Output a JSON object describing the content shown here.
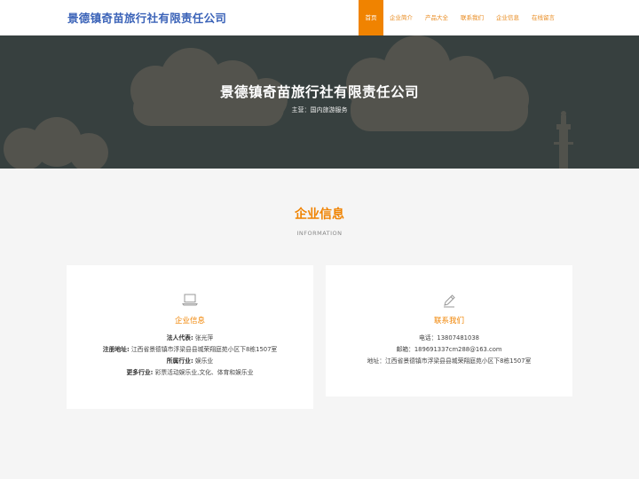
{
  "header": {
    "brand": "景德镇奇苗旅行社有限责任公司",
    "nav": [
      "首页",
      "企业简介",
      "产品大全",
      "联系我们",
      "企业信息",
      "在线留言"
    ]
  },
  "banner": {
    "title": "景德镇奇苗旅行社有限责任公司",
    "subtitle": "主营：国内旅游服务"
  },
  "section": {
    "title": "企业信息",
    "subtitle": "INFORMATION"
  },
  "company_card": {
    "title": "企业信息",
    "legal_label": "法人代表:",
    "legal_value": "张光萍",
    "address_label": "注册地址:",
    "address_value": "江西省景德镇市浮梁县县城荣翔庭苑小区下8栋1507室",
    "industry_label": "所属行业:",
    "industry_value": "娱乐业",
    "more_label": "更多行业:",
    "more_value": "彩票活动娱乐业,文化、体育和娱乐业"
  },
  "contact_card": {
    "title": "联系我们",
    "phone": "电话：13807481038",
    "email": "邮箱：189691337cm288@163.com",
    "address": "地址：江西省景德镇市浮梁县县城荣翔庭苑小区下8栋1507室"
  },
  "colors": {
    "accent": "#f08300",
    "brand": "#3b63b8",
    "banner_bg": "#37403f"
  },
  "icons": {
    "company": "laptop-icon",
    "contact": "pencil-icon"
  }
}
